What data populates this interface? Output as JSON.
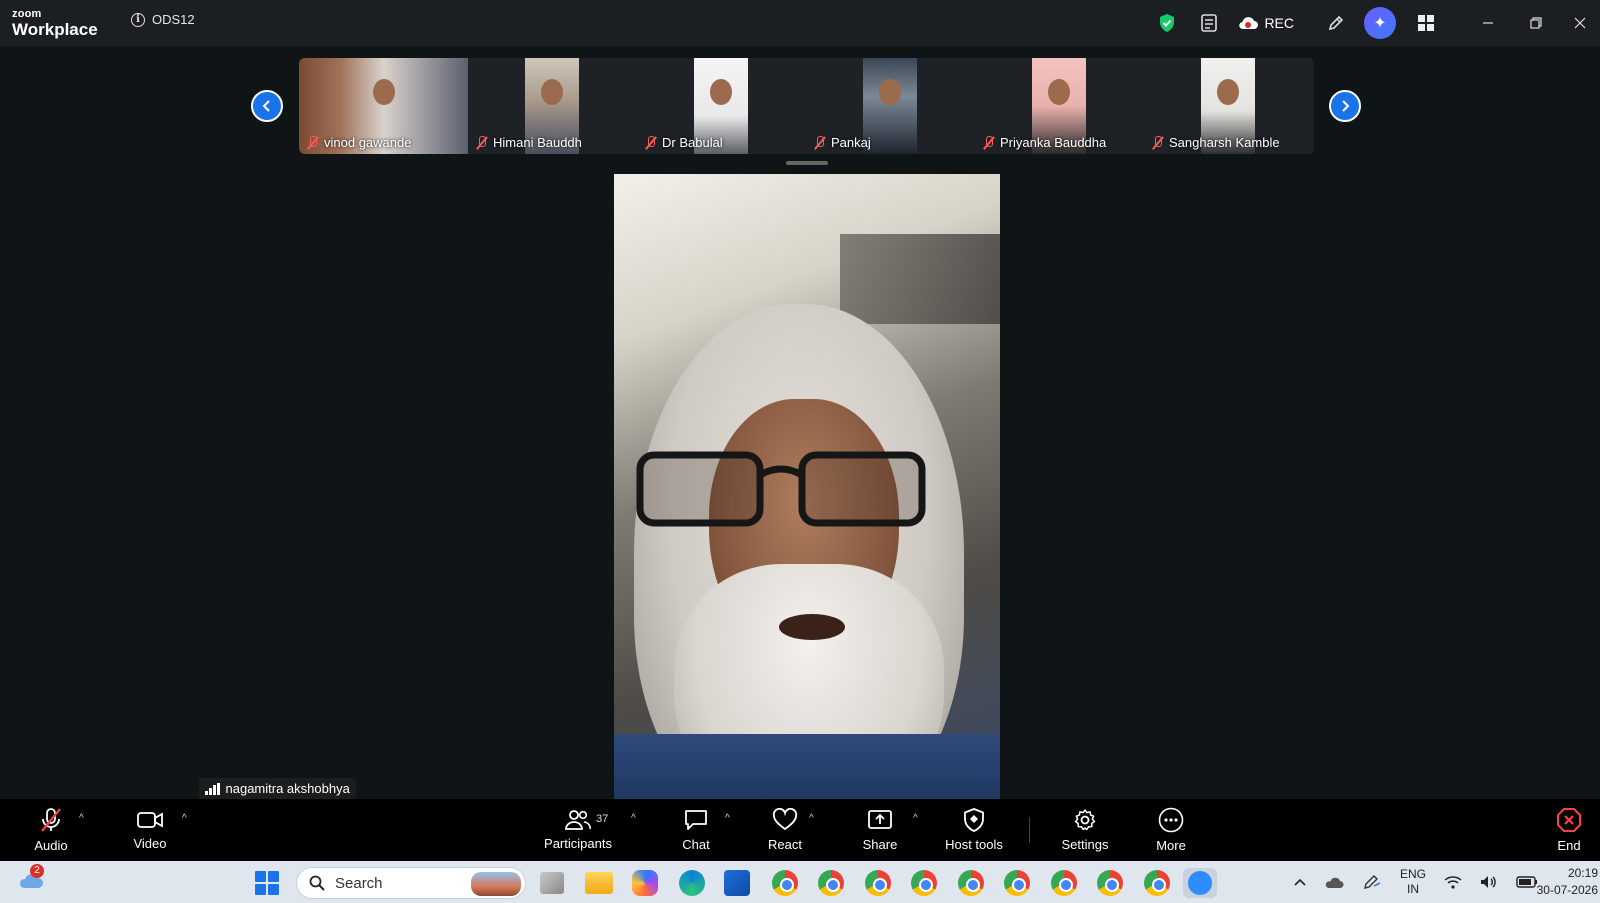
{
  "titlebar": {
    "logo_small": "zoom",
    "logo_big": "Workplace",
    "meeting_id": "ODS12",
    "rec_label": "REC"
  },
  "participants_strip": [
    {
      "name": "vinod gawande"
    },
    {
      "name": "Himani Bauddh"
    },
    {
      "name": "Dr Babulal"
    },
    {
      "name": "Pankaj"
    },
    {
      "name": "Priyanka Bauddha"
    },
    {
      "name": "Sangharsh Kamble"
    }
  ],
  "active_speaker": {
    "name": "nagamitra akshobhya"
  },
  "toolbar": {
    "audio": "Audio",
    "video": "Video",
    "participants": "Participants",
    "participants_count": "37",
    "chat": "Chat",
    "react": "React",
    "share": "Share",
    "host_tools": "Host tools",
    "settings": "Settings",
    "more": "More",
    "end": "End"
  },
  "taskbar": {
    "search_placeholder": "Search",
    "weather_badge": "2",
    "lang_1": "ENG",
    "lang_2": "IN",
    "time": "20:19",
    "date": "30-07-2026"
  },
  "colors": {
    "accent_blue": "#1a73e8",
    "muted_red": "#ff5a5a",
    "end_red": "#e02828",
    "shield_green": "#18c96b"
  }
}
